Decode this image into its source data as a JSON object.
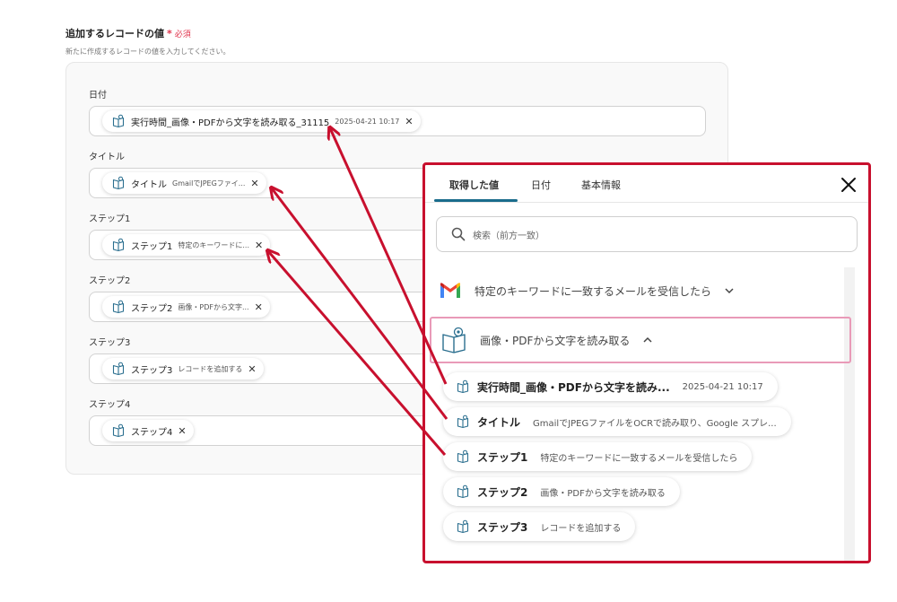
{
  "section": {
    "title": "追加するレコードの値",
    "required_mark": "*",
    "required_text": "必須",
    "description": "新たに作成するレコードの値を入力してください。"
  },
  "fields": [
    {
      "label": "日付",
      "chip": {
        "label": "実行時間_画像・PDFから文字を読み取る_31115",
        "sub": "2025-04-21 10:17",
        "x": "✕"
      }
    },
    {
      "label": "タイトル",
      "chip": {
        "label": "タイトル",
        "sub": "GmailでJPEGファイ...",
        "x": "✕"
      }
    },
    {
      "label": "ステップ1",
      "chip": {
        "label": "ステップ1",
        "sub": "特定のキーワードに...",
        "x": "✕"
      }
    },
    {
      "label": "ステップ2",
      "chip": {
        "label": "ステップ2",
        "sub": "画像・PDFから文字...",
        "x": "✕"
      }
    },
    {
      "label": "ステップ3",
      "chip": {
        "label": "ステップ3",
        "sub": "レコードを追加する",
        "x": "✕"
      }
    },
    {
      "label": "ステップ4",
      "chip": {
        "label": "ステップ4",
        "sub": "",
        "x": "✕"
      }
    }
  ],
  "popup": {
    "tabs": [
      {
        "label": "取得した値",
        "active": true
      },
      {
        "label": "日付",
        "active": false
      },
      {
        "label": "基本情報",
        "active": false
      }
    ],
    "search_placeholder": "検索（前方一致）",
    "groups": [
      {
        "title": "特定のキーワードに一致するメールを受信したら",
        "icon": "gmail-icon",
        "expanded": false
      },
      {
        "title": "画像・PDFから文字を読み取る",
        "icon": "ocr-book-icon",
        "expanded": true
      }
    ],
    "options": [
      {
        "label": "実行時間_画像・PDFから文字を読み...",
        "sub": "2025-04-21 10:17"
      },
      {
        "label": "タイトル",
        "sub": "GmailでJPEGファイルをOCRで読み取り、Google スプレ..."
      },
      {
        "label": "ステップ1",
        "sub": "特定のキーワードに一致するメールを受信したら"
      },
      {
        "label": "ステップ2",
        "sub": "画像・PDFから文字を読み取る"
      },
      {
        "label": "ステップ3",
        "sub": "レコードを追加する"
      }
    ]
  },
  "colors": {
    "annotation_red": "#c8102e",
    "tab_underline": "#1a6c8c",
    "required": "#e0334c",
    "group_highlight": "#e99ab8"
  }
}
